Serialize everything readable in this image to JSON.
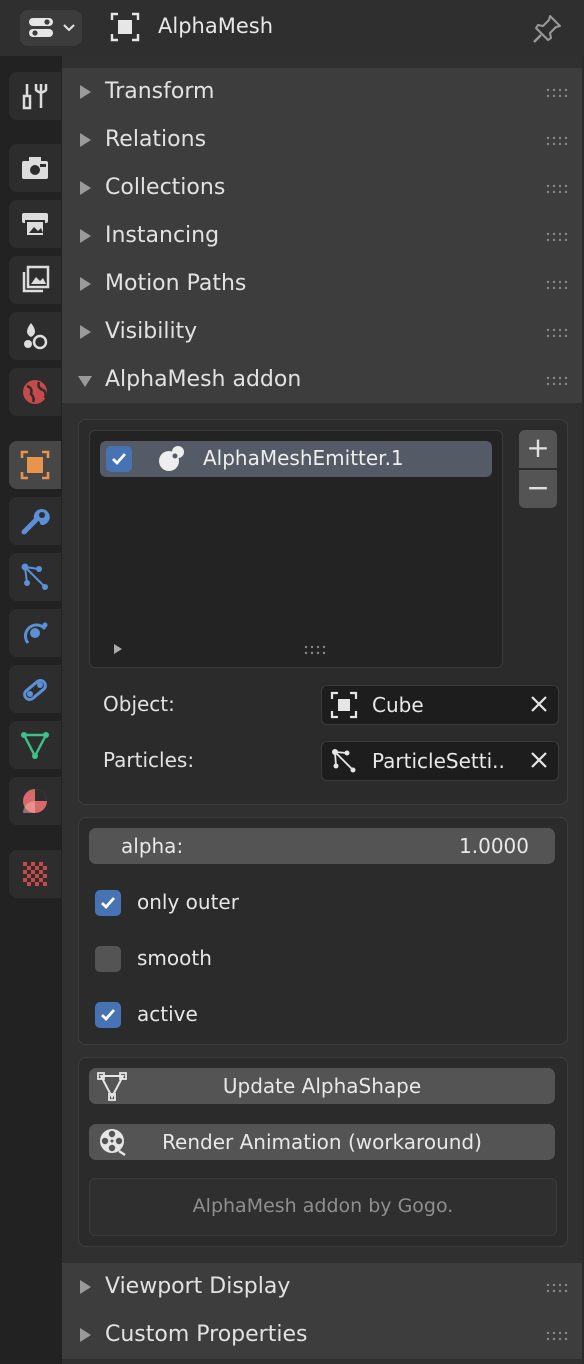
{
  "header": {
    "title": "AlphaMesh",
    "editor_icon": "properties-editor-icon",
    "object_icon": "object-icon",
    "pin_icon": "pin-icon"
  },
  "tabs": [
    {
      "name": "tool",
      "icon": "tool-icon"
    },
    {
      "name": "render",
      "icon": "render-icon"
    },
    {
      "name": "output",
      "icon": "output-icon"
    },
    {
      "name": "view-layer",
      "icon": "view-layer-icon"
    },
    {
      "name": "scene",
      "icon": "scene-icon"
    },
    {
      "name": "world",
      "icon": "world-icon"
    },
    {
      "name": "object",
      "icon": "object-icon",
      "active": true
    },
    {
      "name": "modifiers",
      "icon": "wrench-icon"
    },
    {
      "name": "particles",
      "icon": "particles-icon"
    },
    {
      "name": "physics",
      "icon": "physics-icon"
    },
    {
      "name": "constraints",
      "icon": "constraints-icon"
    },
    {
      "name": "data",
      "icon": "mesh-data-icon"
    },
    {
      "name": "material",
      "icon": "material-icon"
    },
    {
      "name": "texture",
      "icon": "texture-icon"
    }
  ],
  "panels": {
    "transform": "Transform",
    "relations": "Relations",
    "collections": "Collections",
    "instancing": "Instancing",
    "motion_paths": "Motion Paths",
    "visibility": "Visibility",
    "alphamesh": "AlphaMesh addon",
    "viewport_display": "Viewport Display",
    "custom_properties": "Custom Properties"
  },
  "addon": {
    "list": {
      "items": [
        {
          "label": "AlphaMeshEmitter.1",
          "checked": true
        }
      ],
      "add": "+",
      "remove": "−"
    },
    "object_label": "Object:",
    "object_value": "Cube",
    "particles_label": "Particles:",
    "particles_value": "ParticleSetti..",
    "alpha_label": "alpha:",
    "alpha_value": "1.0000",
    "only_outer_label": "only outer",
    "only_outer": true,
    "smooth_label": "smooth",
    "smooth": false,
    "active_label": "active",
    "active": true,
    "update_button": "Update AlphaShape",
    "render_button": "Render Animation (workaround)",
    "credit": "AlphaMesh addon by Gogo."
  },
  "colors": {
    "accent": "#4772b3",
    "active_tab": "#474747",
    "object_orange": "#e8944a"
  }
}
